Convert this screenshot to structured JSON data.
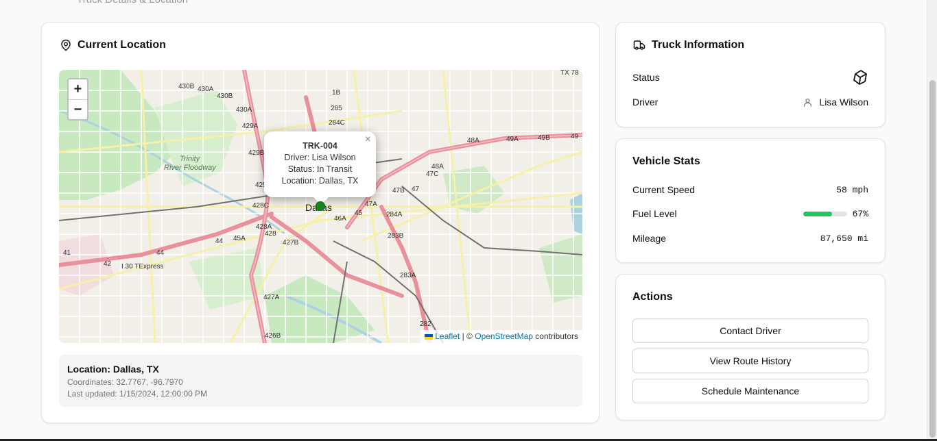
{
  "page": {
    "subtitle": "Truck Details & Location"
  },
  "location_card": {
    "title": "Current Location",
    "map": {
      "zoom_in": "+",
      "zoom_out": "−",
      "popup": {
        "title": "TRK-004",
        "driver": "Driver: Lisa Wilson",
        "status": "Status: In Transit",
        "location": "Location: Dallas, TX",
        "close": "×"
      },
      "city_label": "Dallas",
      "area_label_1": "Trinity",
      "area_label_2": "River Floodway",
      "attribution": {
        "leaflet": "Leaflet",
        "separator": "| ©",
        "osm": "OpenStreetMap",
        "contributors": "contributors"
      },
      "road_labels": [
        "430B",
        "430A",
        "430B",
        "430A",
        "429A",
        "429B",
        "428C",
        "428A",
        "428",
        "427B",
        "427A",
        "426B",
        "1B",
        "285",
        "284C",
        "48A",
        "49A",
        "49B",
        "47C",
        "47B",
        "47",
        "47A",
        "284A",
        "283B",
        "283A",
        "282",
        "45",
        "46A",
        "45A",
        "44",
        "42",
        "41",
        "I 30 TExpress",
        "TX 78"
      ]
    },
    "info": {
      "location": "Location: Dallas, TX",
      "coordinates": "Coordinates: 32.7767, -96.7970",
      "updated": "Last updated: 1/15/2024, 12:00:00 PM"
    }
  },
  "truck_info": {
    "title": "Truck Information",
    "status_label": "Status",
    "status_icon": "cube-icon",
    "driver_label": "Driver",
    "driver_name": "Lisa Wilson"
  },
  "vehicle_stats": {
    "title": "Vehicle Stats",
    "speed_label": "Current Speed",
    "speed_value": "58 mph",
    "fuel_label": "Fuel Level",
    "fuel_percent": 67,
    "fuel_value": "67%",
    "mileage_label": "Mileage",
    "mileage_value": "87,650 mi"
  },
  "actions": {
    "title": "Actions",
    "buttons": [
      "Contact Driver",
      "View Route History",
      "Schedule Maintenance"
    ]
  },
  "colors": {
    "fuel_bar": "#22c55e",
    "marker": "#13871e",
    "link": "#0078a8"
  }
}
